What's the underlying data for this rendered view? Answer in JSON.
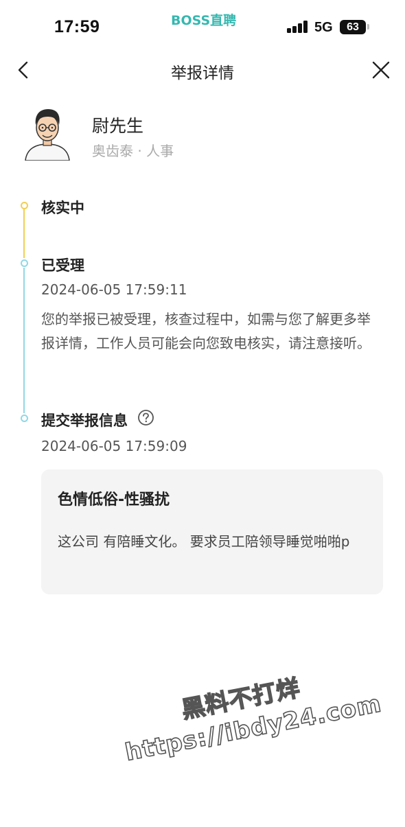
{
  "status_bar": {
    "time": "17:59",
    "app_badge": "BOSS直聘",
    "network": "5G",
    "battery": "63",
    "accent_color": "#35b8b0"
  },
  "nav": {
    "title": "举报详情",
    "back_icon": "chevron-left-icon",
    "close_icon": "close-icon"
  },
  "profile": {
    "name": "尉先生",
    "company_role": "奥齿泰 · 人事"
  },
  "timeline": {
    "colors": {
      "current": "#f2cf52",
      "past": "#8fd8e6"
    },
    "steps": [
      {
        "title": "核实中"
      },
      {
        "title": "已受理",
        "time": "2024-06-05 17:59:11",
        "description": "您的举报已被受理，核查过程中，如需与您了解更多举报详情，工作人员可能会向您致电核实，请注意接听。"
      },
      {
        "title": "提交举报信息",
        "time": "2024-06-05 17:59:09",
        "help_icon": "question-circle-icon"
      }
    ]
  },
  "report": {
    "category": "色情低俗-性骚扰",
    "content": "这公司 有陪睡文化。 要求员工陪领导睡觉啪啪p"
  },
  "watermark": {
    "line1": "黑料不打烊",
    "line2": "https://ibdy24.com"
  }
}
